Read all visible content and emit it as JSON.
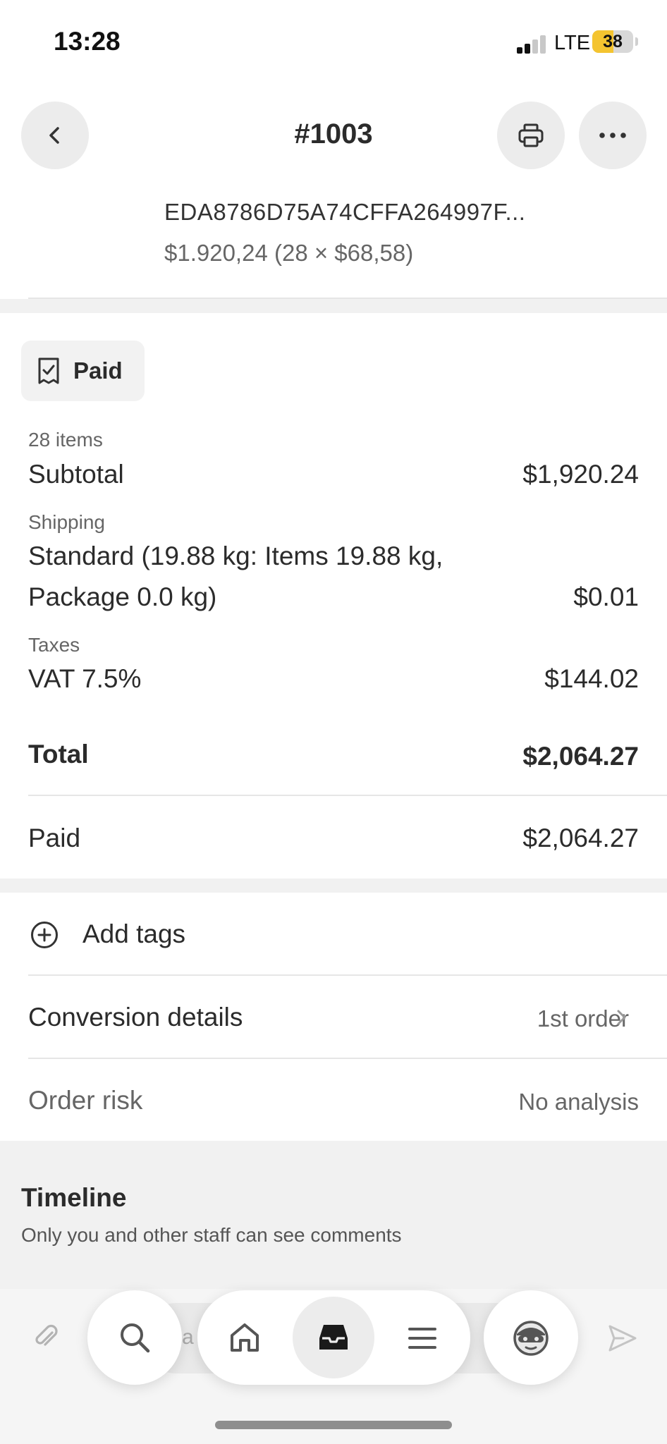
{
  "status_bar": {
    "time": "13:28",
    "network": "LTE",
    "battery": "38"
  },
  "header": {
    "title": "#1003"
  },
  "line_item": {
    "id": "EDA8786D75A74CFFA264997F...",
    "price_detail": "$1.920,24 (28 × $68,58)"
  },
  "payment": {
    "status_badge": "Paid",
    "items_count": "28 items",
    "subtotal_label": "Subtotal",
    "subtotal_value": "$1,920.24",
    "shipping_label": "Shipping",
    "shipping_line1": "Standard (19.88 kg: Items 19.88 kg,",
    "shipping_line2": "Package 0.0 kg)",
    "shipping_value": "$0.01",
    "taxes_label": "Taxes",
    "tax_line": "VAT 7.5%",
    "tax_value": "$144.02",
    "total_label": "Total",
    "total_value": "$2,064.27",
    "paid_label": "Paid",
    "paid_value": "$2,064.27"
  },
  "details": {
    "add_tags": "Add tags",
    "conversion_label": "Conversion details",
    "conversion_value": "1st order",
    "risk_label": "Order risk",
    "risk_value": "No analysis"
  },
  "timeline": {
    "title": "Timeline",
    "subtitle": "Only you and other staff can see comments",
    "comment_placeholder": "a"
  },
  "icons": {
    "back": "chevron-left-icon",
    "print": "printer-icon",
    "more": "ellipsis-icon",
    "paid": "receipt-check-icon",
    "add": "plus-circle-icon",
    "attach": "paperclip-icon",
    "search": "search-icon",
    "home": "home-icon",
    "orders": "inbox-icon",
    "menu": "menu-icon",
    "avatar": "user-avatar-icon",
    "send": "send-icon"
  }
}
